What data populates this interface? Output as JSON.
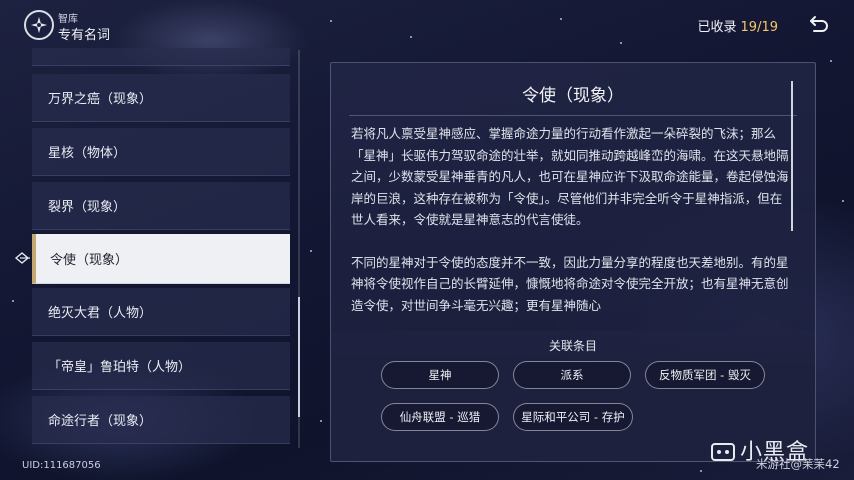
{
  "header": {
    "subtitle": "智库",
    "title": "专有名词",
    "collected_label": "已收录",
    "collected_count": "19/19"
  },
  "list": {
    "items": [
      {
        "label": "万界之癌（现象）",
        "selected": false
      },
      {
        "label": "星核（物体）",
        "selected": false
      },
      {
        "label": "裂界（现象）",
        "selected": false
      },
      {
        "label": "令使（现象）",
        "selected": true
      },
      {
        "label": "绝灭大君（人物）",
        "selected": false
      },
      {
        "label": "「帝皇」鲁珀特（人物）",
        "selected": false
      },
      {
        "label": "命途行者（现象）",
        "selected": false
      }
    ]
  },
  "detail": {
    "title": "令使（现象）",
    "paragraphs": [
      "若将凡人禀受星神感应、掌握命途力量的行动看作激起一朵碎裂的飞沫；那么「星神」长驱伟力驾驭命途的壮举，就如同推动跨越峰峦的海啸。在这天悬地隔之间，少数蒙受星神垂青的凡人，也可在星神应许下汲取命途能量，卷起侵蚀海岸的巨浪，这种存在被称为「令使」。尽管他们并非完全听令于星神指派，但在世人看来，令使就是星神意志的代言使徒。",
      "不同的星神对于令使的态度并不一致，因此力量分享的程度也天差地别。有的星神将令使视作自己的长臂延伸，慷慨地将命途对令使完全开放；也有星神无意创造令使，对世间争斗毫无兴趣；更有星神随心"
    ],
    "related_label": "关联条目",
    "related": [
      "星神",
      "派系",
      "反物质军团 - 毁灭",
      "仙舟联盟 - 巡猎",
      "星际和平公司 - 存护"
    ]
  },
  "footer": {
    "uid": "UID:111687056",
    "watermark_logo": "小黑盒",
    "watermark_user": "米游社@苿苿42"
  },
  "colors": {
    "accent_gold": "#f4c86a",
    "selected_bg": "#eef0f4",
    "background": "#131733"
  },
  "icons": [
    "astral-logo-icon",
    "back-arrow-icon",
    "selected-marker-icon",
    "watermark-box-icon"
  ]
}
